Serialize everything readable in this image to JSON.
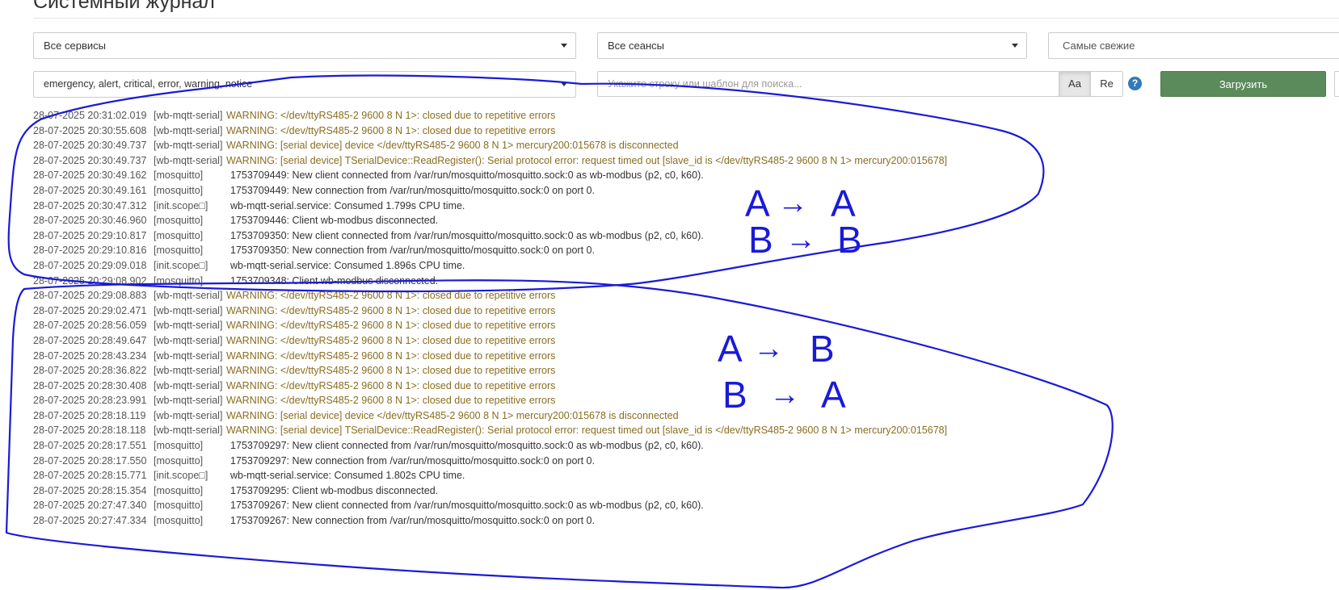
{
  "page": {
    "title": "Системный журнал"
  },
  "filters": {
    "services": "Все сервисы",
    "sessions": "Все сеансы",
    "order": "Самые свежие",
    "levels": "emergency, alert, critical, error, warning, notice"
  },
  "search": {
    "placeholder": "Укажите строку или шаблон для поиска...",
    "case_label": "Aa",
    "regex_label": "Re",
    "help_icon": "?"
  },
  "actions": {
    "load_label": "Загрузить"
  },
  "log_entries": [
    {
      "time": "28-07-2025 20:31:02.019",
      "service": "[wb-mqtt-serial]",
      "message": "WARNING: </dev/ttyRS485-2 9600 8 N 1>: closed due to repetitive errors",
      "level": "warning"
    },
    {
      "time": "28-07-2025 20:30:55.608",
      "service": "[wb-mqtt-serial]",
      "message": "WARNING: </dev/ttyRS485-2 9600 8 N 1>: closed due to repetitive errors",
      "level": "warning"
    },
    {
      "time": "28-07-2025 20:30:49.737",
      "service": "[wb-mqtt-serial]",
      "message": "WARNING: [serial device] device </dev/ttyRS485-2 9600 8 N 1> mercury200:015678 is disconnected",
      "level": "warning"
    },
    {
      "time": "28-07-2025 20:30:49.737",
      "service": "[wb-mqtt-serial]",
      "message": "WARNING: [serial device] TSerialDevice::ReadRegister(): Serial protocol error: request timed out [slave_id is </dev/ttyRS485-2 9600 8 N 1> mercury200:015678]",
      "level": "warning"
    },
    {
      "time": "28-07-2025 20:30:49.162",
      "service": "[mosquitto]",
      "message": "1753709449: New client connected from /var/run/mosquitto/mosquitto.sock:0 as wb-modbus (p2, c0, k60).",
      "level": "info"
    },
    {
      "time": "28-07-2025 20:30:49.161",
      "service": "[mosquitto]",
      "message": "1753709449: New connection from /var/run/mosquitto/mosquitto.sock:0 on port 0.",
      "level": "info"
    },
    {
      "time": "28-07-2025 20:30:47.312",
      "service": "[init.scope□]",
      "message": "wb-mqtt-serial.service: Consumed 1.799s CPU time.",
      "level": "info"
    },
    {
      "time": "28-07-2025 20:30:46.960",
      "service": "[mosquitto]",
      "message": "1753709446: Client wb-modbus disconnected.",
      "level": "info"
    },
    {
      "time": "28-07-2025 20:29:10.817",
      "service": "[mosquitto]",
      "message": "1753709350: New client connected from /var/run/mosquitto/mosquitto.sock:0 as wb-modbus (p2, c0, k60).",
      "level": "info"
    },
    {
      "time": "28-07-2025 20:29:10.816",
      "service": "[mosquitto]",
      "message": "1753709350: New connection from /var/run/mosquitto/mosquitto.sock:0 on port 0.",
      "level": "info"
    },
    {
      "time": "28-07-2025 20:29:09.018",
      "service": "[init.scope□]",
      "message": "wb-mqtt-serial.service: Consumed 1.896s CPU time.",
      "level": "info"
    },
    {
      "time": "28-07-2025 20:29:08.902",
      "service": "[mosquitto]",
      "message": "1753709348: Client wb-modbus disconnected.",
      "level": "info"
    },
    {
      "time": "28-07-2025 20:29:08.883",
      "service": "[wb-mqtt-serial]",
      "message": "WARNING: </dev/ttyRS485-2 9600 8 N 1>: closed due to repetitive errors",
      "level": "warning"
    },
    {
      "time": "28-07-2025 20:29:02.471",
      "service": "[wb-mqtt-serial]",
      "message": "WARNING: </dev/ttyRS485-2 9600 8 N 1>: closed due to repetitive errors",
      "level": "warning"
    },
    {
      "time": "28-07-2025 20:28:56.059",
      "service": "[wb-mqtt-serial]",
      "message": "WARNING: </dev/ttyRS485-2 9600 8 N 1>: closed due to repetitive errors",
      "level": "warning"
    },
    {
      "time": "28-07-2025 20:28:49.647",
      "service": "[wb-mqtt-serial]",
      "message": "WARNING: </dev/ttyRS485-2 9600 8 N 1>: closed due to repetitive errors",
      "level": "warning"
    },
    {
      "time": "28-07-2025 20:28:43.234",
      "service": "[wb-mqtt-serial]",
      "message": "WARNING: </dev/ttyRS485-2 9600 8 N 1>: closed due to repetitive errors",
      "level": "warning"
    },
    {
      "time": "28-07-2025 20:28:36.822",
      "service": "[wb-mqtt-serial]",
      "message": "WARNING: </dev/ttyRS485-2 9600 8 N 1>: closed due to repetitive errors",
      "level": "warning"
    },
    {
      "time": "28-07-2025 20:28:30.408",
      "service": "[wb-mqtt-serial]",
      "message": "WARNING: </dev/ttyRS485-2 9600 8 N 1>: closed due to repetitive errors",
      "level": "warning"
    },
    {
      "time": "28-07-2025 20:28:23.991",
      "service": "[wb-mqtt-serial]",
      "message": "WARNING: </dev/ttyRS485-2 9600 8 N 1>: closed due to repetitive errors",
      "level": "warning"
    },
    {
      "time": "28-07-2025 20:28:18.119",
      "service": "[wb-mqtt-serial]",
      "message": "WARNING: [serial device] device </dev/ttyRS485-2 9600 8 N 1> mercury200:015678 is disconnected",
      "level": "warning"
    },
    {
      "time": "28-07-2025 20:28:18.118",
      "service": "[wb-mqtt-serial]",
      "message": "WARNING: [serial device] TSerialDevice::ReadRegister(): Serial protocol error: request timed out [slave_id is </dev/ttyRS485-2 9600 8 N 1> mercury200:015678]",
      "level": "warning"
    },
    {
      "time": "28-07-2025 20:28:17.551",
      "service": "[mosquitto]",
      "message": "1753709297: New client connected from /var/run/mosquitto/mosquitto.sock:0 as wb-modbus (p2, c0, k60).",
      "level": "info"
    },
    {
      "time": "28-07-2025 20:28:17.550",
      "service": "[mosquitto]",
      "message": "1753709297: New connection from /var/run/mosquitto/mosquitto.sock:0 on port 0.",
      "level": "info"
    },
    {
      "time": "28-07-2025 20:28:15.771",
      "service": "[init.scope□]",
      "message": "wb-mqtt-serial.service: Consumed 1.802s CPU time.",
      "level": "info"
    },
    {
      "time": "28-07-2025 20:28:15.354",
      "service": "[mosquitto]",
      "message": "1753709295: Client wb-modbus disconnected.",
      "level": "info"
    },
    {
      "time": "28-07-2025 20:27:47.340",
      "service": "[mosquitto]",
      "message": "1753709267: New client connected from /var/run/mosquitto/mosquitto.sock:0 as wb-modbus (p2, c0, k60).",
      "level": "info"
    },
    {
      "time": "28-07-2025 20:27:47.334",
      "service": "[mosquitto]",
      "message": "1753709267: New connection from /var/run/mosquitto/mosquitto.sock:0 on port 0.",
      "level": "info"
    }
  ],
  "annotations": {
    "upper": [
      {
        "from": "A",
        "to": "A"
      },
      {
        "from": "B",
        "to": "B"
      }
    ],
    "lower": [
      {
        "from": "A",
        "to": "B"
      },
      {
        "from": "B",
        "to": "A"
      }
    ],
    "arrow_glyph": "→",
    "ink_color": "#1a1ad8"
  },
  "colors": {
    "warning_text": "#8a6d1f",
    "load_button": "#5b8a5b",
    "help_icon": "#337ab7"
  }
}
